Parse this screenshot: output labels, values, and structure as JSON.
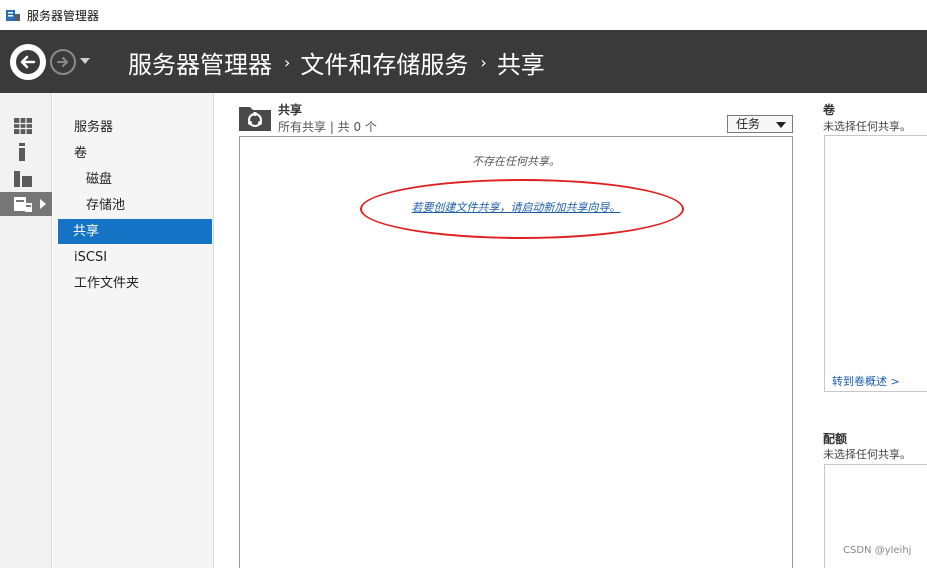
{
  "window": {
    "title": "服务器管理器"
  },
  "header": {
    "breadcrumb": [
      "服务器管理器",
      "文件和存储服务",
      "共享"
    ],
    "separator": "›"
  },
  "rail": {
    "items": [
      {
        "icon": "dashboard-grid-icon"
      },
      {
        "icon": "info-icon"
      },
      {
        "icon": "all-servers-icon"
      },
      {
        "icon": "file-storage-icon",
        "active": true
      }
    ]
  },
  "navpane": {
    "items": [
      {
        "label": "服务器"
      },
      {
        "label": "卷"
      },
      {
        "label": "磁盘",
        "sub": true
      },
      {
        "label": "存储池",
        "sub": true
      },
      {
        "label": "共享",
        "active": true
      },
      {
        "label": "iSCSI"
      },
      {
        "label": "工作文件夹"
      }
    ]
  },
  "content": {
    "title": "共享",
    "subtitle": "所有共享 | 共 0 个",
    "tasks_label": "任务",
    "empty_message": "不存在任何共享。",
    "wizard_link": "若要创建文件共享，请启动新加共享向导。"
  },
  "rightpanel": {
    "volume": {
      "heading": "卷",
      "subtitle": "未选择任何共享。",
      "link": "转到卷概述 >"
    },
    "quota": {
      "heading": "配额",
      "subtitle": "未选择任何共享。"
    }
  },
  "watermark": "CSDN @yleihj",
  "colors": {
    "header_bg": "#3a3a3a",
    "selection": "#1473c5",
    "link": "#1c5ea8",
    "annotation": "#e02020"
  }
}
